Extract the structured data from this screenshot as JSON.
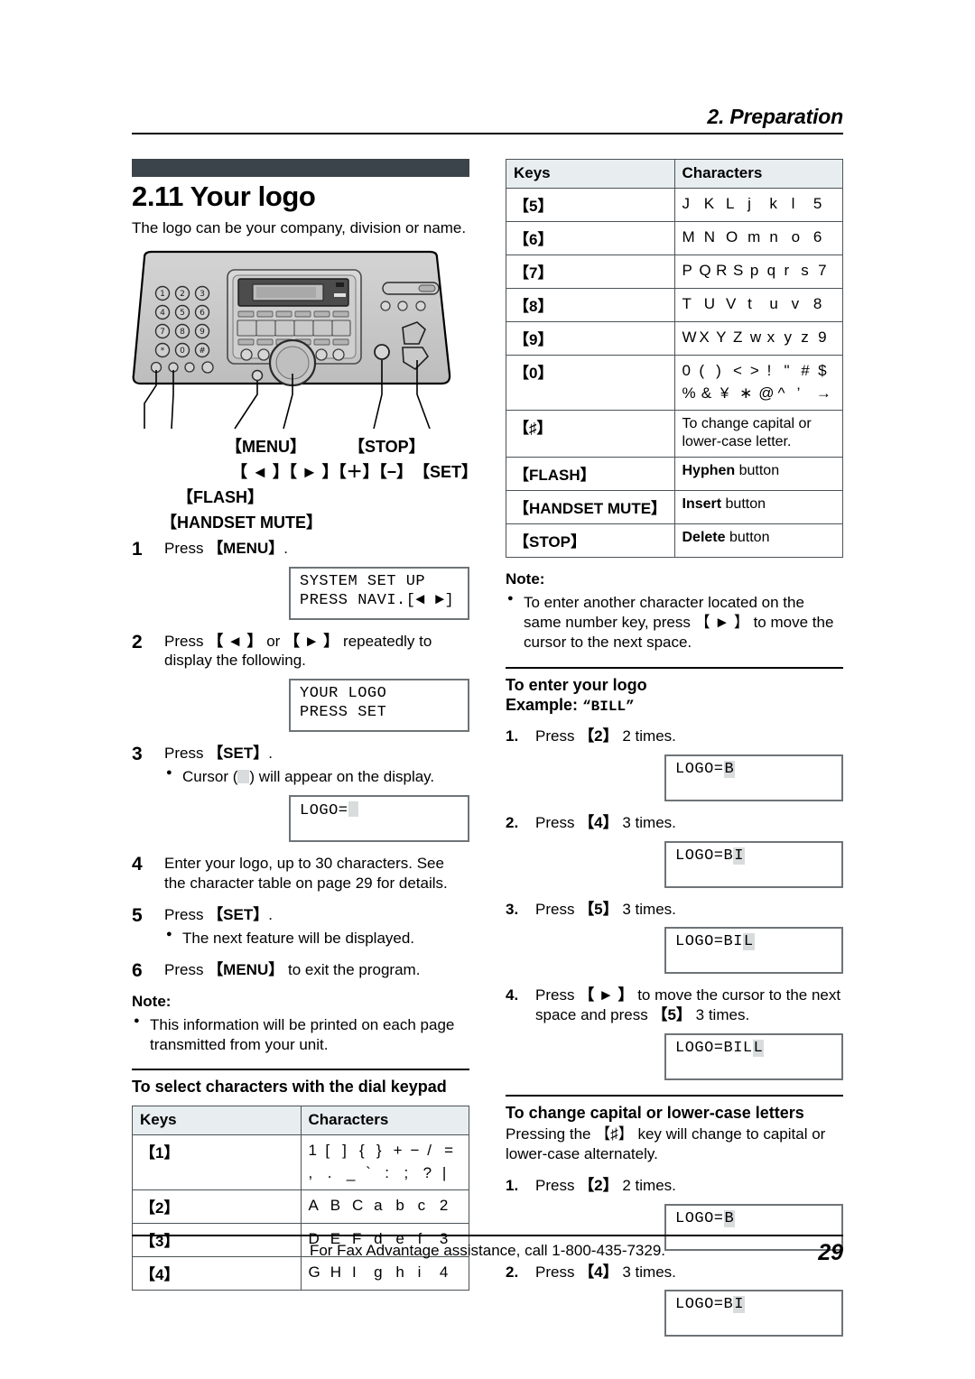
{
  "running_head": "2. Preparation",
  "section": {
    "number_title": "2.11 Your logo",
    "lead": "The logo can be your company, division or name."
  },
  "illustration": {
    "name": "fax-machine-control-panel",
    "callouts": {
      "menu": "【MENU】",
      "stop": "【STOP】",
      "navigation": "【 ◄ 】【 ► 】【＋】【−】",
      "set": "【SET】",
      "flash": "【FLASH】",
      "handset_mute": "【HANDSET MUTE】"
    }
  },
  "steps": [
    {
      "num": "1",
      "text_html": "Press <b>【MENU】</b>."
    },
    {
      "num": "2",
      "text_html": "Press <b>【 ◄ 】</b> or <b>【 ► 】</b> repeatedly to display the following."
    },
    {
      "num": "3",
      "text_html": "Press <b>【SET】</b>."
    },
    {
      "num": "4",
      "text_html": "Enter your logo, up to 30 characters. See the character table on page 29 for details."
    },
    {
      "num": "5",
      "text_html": "Press <b>【SET】</b>."
    },
    {
      "num": "6",
      "text_html": "Press <b>【MENU】</b> to exit the program."
    }
  ],
  "step3_bullet": "Cursor ( ) will appear on the display.",
  "step3_bullet_pre": "Cursor (",
  "step3_bullet_post": ") will appear on the display.",
  "step5_bullet": "The next feature will be displayed.",
  "displays": {
    "d1_line1": "SYSTEM SET UP",
    "d1_line2": "PRESS NAVI.[◄ ►]",
    "d2_line1": "YOUR LOGO",
    "d2_line2": "PRESS SET",
    "d3_prefix": "LOGO=",
    "logo_b": "LOGO=B",
    "logo_bi": "LOGO=BI",
    "logo_bil": "LOGO=BIL",
    "logo_bill": "LOGO=BILL",
    "prefix": "LOGO=",
    "v_b": "B",
    "v_bi_static": "B",
    "v_bi_cursor": "I",
    "v_bil_static": "BI",
    "v_bil_cursor": "L",
    "v_bill_static": "BIL",
    "v_bill_cursor": "L"
  },
  "note_left": {
    "heading": "Note:",
    "bullet": "This information will be printed on each page transmitted from your unit."
  },
  "table_left": {
    "heading": "To select characters with the dial keypad",
    "columns": [
      "Keys",
      "Characters"
    ],
    "rows": [
      {
        "key": "【1】",
        "lines": [
          [
            "1",
            "[",
            "]",
            "{",
            "}",
            "+",
            "−",
            "/",
            "="
          ],
          [
            ",",
            ".",
            "_",
            "`",
            ":",
            ";",
            "?",
            "|"
          ]
        ]
      },
      {
        "key": "【2】",
        "lines": [
          [
            "A",
            "B",
            "C",
            "a",
            "b",
            "c",
            "2"
          ]
        ]
      },
      {
        "key": "【3】",
        "lines": [
          [
            "D",
            "E",
            "F",
            "d",
            "e",
            "f",
            "3"
          ]
        ]
      },
      {
        "key": "【4】",
        "lines": [
          [
            "G",
            "H",
            "I",
            "g",
            "h",
            "i",
            "4"
          ]
        ]
      }
    ]
  },
  "table_right": {
    "columns": [
      "Keys",
      "Characters"
    ],
    "rows": [
      {
        "key": "【5】",
        "lines": [
          [
            "J",
            "K",
            "L",
            "j",
            "k",
            "l",
            "5"
          ]
        ]
      },
      {
        "key": "【6】",
        "lines": [
          [
            "M",
            "N",
            "O",
            "m",
            "n",
            "o",
            "6"
          ]
        ]
      },
      {
        "key": "【7】",
        "lines": [
          [
            "P",
            "Q",
            "R",
            "S",
            "p",
            "q",
            "r",
            "s",
            "7"
          ]
        ]
      },
      {
        "key": "【8】",
        "lines": [
          [
            "T",
            "U",
            "V",
            "t",
            "u",
            "v",
            "8"
          ]
        ]
      },
      {
        "key": "【9】",
        "lines": [
          [
            "W",
            "X",
            "Y",
            "Z",
            "w",
            "x",
            "y",
            "z",
            "9"
          ]
        ]
      },
      {
        "key": "【0】",
        "lines": [
          [
            "0",
            "(",
            ")",
            "<",
            ">",
            "!",
            "\"",
            "#",
            "$"
          ],
          [
            "%",
            "&",
            "¥",
            "∗",
            "@",
            "^",
            "’",
            "→"
          ]
        ]
      },
      {
        "key": "【♯】",
        "text": "To change capital or lower-case letter."
      },
      {
        "key": "【FLASH】",
        "text_bold": "Hyphen",
        "text_rest": " button"
      },
      {
        "key": "【HANDSET MUTE】",
        "text_bold": "Insert",
        "text_rest": " button"
      },
      {
        "key": "【STOP】",
        "text_bold": "Delete",
        "text_rest": " button"
      }
    ]
  },
  "note_right": {
    "heading": "Note:",
    "bullet": "To enter another character located on the same number key, press 【 ► 】 to move the cursor to the next space."
  },
  "enter_logo": {
    "heading": "To enter your logo",
    "example_label": "Example:",
    "example_value": "“BILL”",
    "steps": [
      {
        "num": "1.",
        "text_html": "Press <b>【2】</b> 2 times."
      },
      {
        "num": "2.",
        "text_html": "Press <b>【4】</b> 3 times."
      },
      {
        "num": "3.",
        "text_html": "Press <b>【5】</b> 3 times."
      },
      {
        "num": "4.",
        "text_html": "Press <b>【 ► 】</b> to move the cursor to the next space and press <b>【5】</b> 3 times."
      }
    ]
  },
  "change_case": {
    "heading": "To change capital or lower-case letters",
    "para": "Pressing the 【♯】 key will change to capital or lower-case alternately.",
    "steps": [
      {
        "num": "1.",
        "text_html": "Press <b>【2】</b> 2 times."
      },
      {
        "num": "2.",
        "text_html": "Press <b>【4】</b> 3 times."
      }
    ]
  },
  "footer": {
    "center": "For Fax Advantage assistance, call 1-800-435-7329.",
    "page": "29"
  },
  "colors": {
    "section_bar": "#3b444a",
    "table_header_bg": "#e8eef0",
    "table_border": "#4c5356",
    "lcd_border": "#6d7478",
    "cursor": "#d9dcdd"
  }
}
